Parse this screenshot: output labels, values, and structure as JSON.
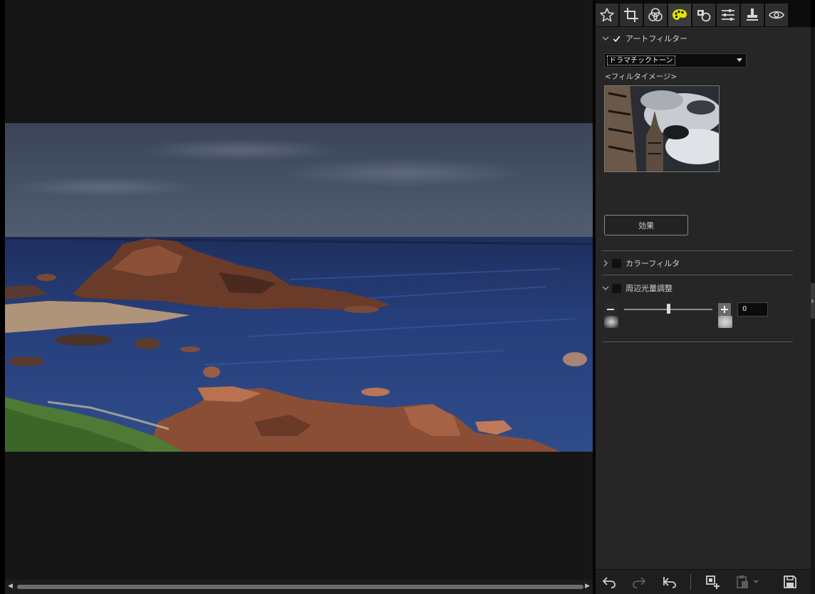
{
  "toolbar": {
    "tabs": [
      {
        "icon": "star-icon",
        "name": "rating"
      },
      {
        "icon": "crop-icon",
        "name": "crop"
      },
      {
        "icon": "color-circles-icon",
        "name": "color-adjust"
      },
      {
        "icon": "palette-icon",
        "name": "art-filter",
        "active": true
      },
      {
        "icon": "retouch-icon",
        "name": "retouch"
      },
      {
        "icon": "sliders-icon",
        "name": "adjustments"
      },
      {
        "icon": "stamp-icon",
        "name": "stamp"
      },
      {
        "icon": "eye-icon",
        "name": "view"
      }
    ],
    "active_color": "#e6e600"
  },
  "art_filter": {
    "label": "アートフィルター",
    "checked": true,
    "expanded": true,
    "selected_filter": "ドラマチックトーン",
    "image_label": "<フィルタイメージ>",
    "effect_button": "効果"
  },
  "color_filter": {
    "label": "カラーフィルタ",
    "checked": false,
    "expanded": false
  },
  "vignette": {
    "label": "周辺光量調整",
    "checked": false,
    "expanded": true,
    "value": "0",
    "slider_position": 0.5
  },
  "bottom_bar": {
    "buttons": [
      "undo-icon",
      "redo-icon",
      "reset-icon",
      "add-copy-icon",
      "paste-icon",
      "save-icon"
    ]
  },
  "colors": {
    "panel_bg": "#262626",
    "viewer_bg": "#161616",
    "accent_yellow": "#e6e600"
  }
}
